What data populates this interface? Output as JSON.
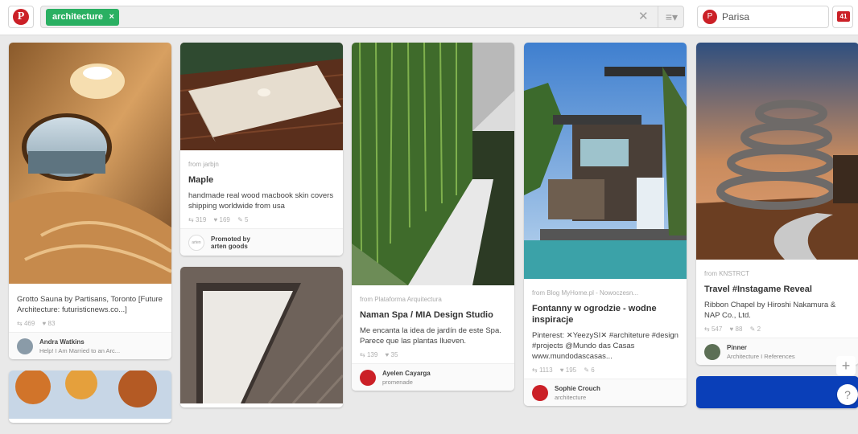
{
  "header": {
    "search_tag": "architecture",
    "tag_remove": "×",
    "clear_search": "✕",
    "menu_icon": "≡▾",
    "user_name": "Parisa",
    "notification_count": "41"
  },
  "pins": {
    "sauna": {
      "desc": "Grotto Sauna by Partisans, Toronto [Future Architecture: futuristicnews.co...]",
      "repins": "469",
      "likes": "83",
      "user": "Andra Watkins",
      "board": "Help! I Am Married to an Arc..."
    },
    "maple": {
      "source": "from jarbjn",
      "title": "Maple",
      "desc": "handmade real wood macbook skin covers shipping worldwide from usa",
      "repins": "319",
      "likes": "169",
      "comments": "5",
      "promoted_label": "Promoted by",
      "promoted_by": "arten goods",
      "avatar_text": "arten"
    },
    "spa": {
      "source": "from Plataforma Arquitectura",
      "title": "Naman Spa / MIA Design Studio",
      "desc": "Me encanta la idea de jardín de este Spa. Parece que las plantas llueven.",
      "repins": "139",
      "likes": "35",
      "user": "Ayelen Cayarga",
      "board": "promenade"
    },
    "fontanny": {
      "source": "from Blog MyHome.pl - Nowoczesn...",
      "title": "Fontanny w ogrodzie - wodne inspiracje",
      "desc": "Pinterest: ✕YeezySI✕ #architeture #design #projects @Mundo das Casas www.mundodascasas...",
      "repins": "1113",
      "likes": "195",
      "comments": "6",
      "user": "Sophie Crouch",
      "board": "architecture"
    },
    "ribbon": {
      "source": "from KNSTRCT",
      "title": "Travel #Instagame Reveal",
      "desc": "Ribbon Chapel by Hiroshi Nakamura & NAP Co., Ltd.",
      "repins": "547",
      "likes": "88",
      "comments": "2",
      "user": "Pinner",
      "board": "Architecture I References"
    }
  },
  "widgets": {
    "add_label": "+",
    "help_label": "?"
  },
  "colors": {
    "brand": "#cb2027",
    "tag": "#2ab062"
  }
}
